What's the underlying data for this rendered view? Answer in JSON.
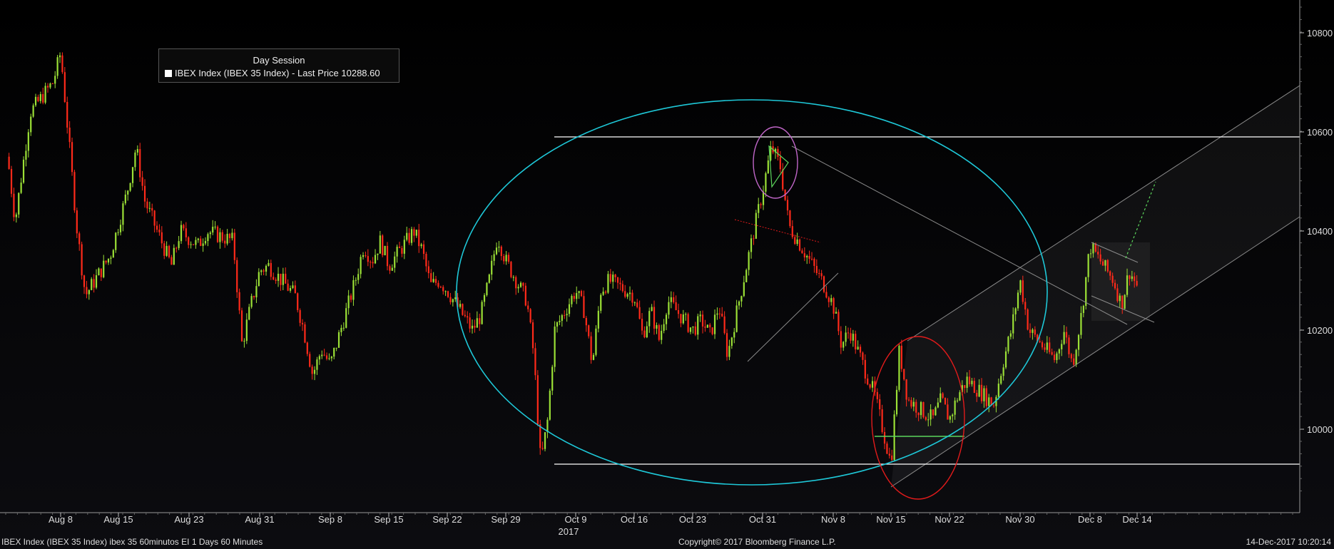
{
  "legend": {
    "session": "Day Session",
    "series_label": "IBEX Index (IBEX 35 Index) - Last Price 10288.60"
  },
  "footer": {
    "left": "IBEX Index (IBEX 35 Index) ibex 35 60minutos EI 1 Days 60 Minutes",
    "center": "Copyright© 2017 Bloomberg Finance L.P.",
    "right": "14-Dec-2017 10:20:14"
  },
  "colors": {
    "up": "#9be036",
    "down": "#ff2a1a",
    "background": "#000000",
    "cyan_ellipse": "#1ec8d8",
    "red_ellipse": "#e11b1b",
    "purple_ellipse": "#c066c8",
    "trend_lines": "#8a8a8a",
    "horizontal_lines": "#ffffff",
    "green_line": "#5cd65c"
  },
  "chart_data": {
    "type": "candlestick",
    "title": "",
    "series_name": "IBEX Index (IBEX 35 Index) - Last Price",
    "last_price": 10288.6,
    "interval": "60 Minutes",
    "y_axis": {
      "side": "right",
      "ticks": [
        10000,
        10200,
        10400,
        10600,
        10800
      ],
      "range": [
        9870,
        10870
      ]
    },
    "x_axis": {
      "ticks": [
        "Aug 8",
        "Aug 15",
        "Aug 23",
        "Aug 31",
        "Sep 8",
        "Sep 15",
        "Sep 22",
        "Sep 29",
        "Oct 9",
        "Oct 16",
        "Oct 23",
        "Oct 31",
        "Nov 8",
        "Nov 15",
        "Nov 22",
        "Nov 30",
        "Dec 8",
        "Dec 14"
      ],
      "year_label": "2017",
      "year_under": "Oct 9"
    },
    "grid": false,
    "legend_position": "top-left",
    "price_path": [
      [
        "Aug 1",
        10550
      ],
      [
        "Aug 2",
        10420
      ],
      [
        "Aug 4",
        10640
      ],
      [
        "Aug 7",
        10700
      ],
      [
        "Aug 8",
        10760
      ],
      [
        "Aug 9",
        10580
      ],
      [
        "Aug 10",
        10400
      ],
      [
        "Aug 11",
        10270
      ],
      [
        "Aug 14",
        10350
      ],
      [
        "Aug 16",
        10480
      ],
      [
        "Aug 17",
        10570
      ],
      [
        "Aug 18",
        10460
      ],
      [
        "Aug 21",
        10330
      ],
      [
        "Aug 22",
        10400
      ],
      [
        "Aug 24",
        10370
      ],
      [
        "Aug 25",
        10400
      ],
      [
        "Aug 28",
        10380
      ],
      [
        "Aug 29",
        10170
      ],
      [
        "Aug 30",
        10250
      ],
      [
        "Aug 31",
        10320
      ],
      [
        "Sep 1",
        10330
      ],
      [
        "Sep 4",
        10270
      ],
      [
        "Sep 5",
        10200
      ],
      [
        "Sep 6",
        10110
      ],
      [
        "Sep 7",
        10160
      ],
      [
        "Sep 8",
        10130
      ],
      [
        "Sep 11",
        10300
      ],
      [
        "Sep 12",
        10370
      ],
      [
        "Sep 13",
        10340
      ],
      [
        "Sep 14",
        10380
      ],
      [
        "Sep 15",
        10330
      ],
      [
        "Sep 18",
        10400
      ],
      [
        "Sep 19",
        10360
      ],
      [
        "Sep 20",
        10290
      ],
      [
        "Sep 21",
        10300
      ],
      [
        "Sep 22",
        10280
      ],
      [
        "Sep 25",
        10200
      ],
      [
        "Sep 26",
        10230
      ],
      [
        "Sep 27",
        10300
      ],
      [
        "Sep 28",
        10390
      ],
      [
        "Sep 29",
        10340
      ],
      [
        "Oct 2",
        10260
      ],
      [
        "Oct 3",
        10150
      ],
      [
        "Oct 4",
        9930
      ],
      [
        "Oct 5",
        10020
      ],
      [
        "Oct 6",
        10200
      ],
      [
        "Oct 9",
        10280
      ],
      [
        "Oct 10",
        10240
      ],
      [
        "Oct 11",
        10130
      ],
      [
        "Oct 12",
        10280
      ],
      [
        "Oct 13",
        10300
      ],
      [
        "Oct 16",
        10270
      ],
      [
        "Oct 17",
        10190
      ],
      [
        "Oct 18",
        10240
      ],
      [
        "Oct 19",
        10180
      ],
      [
        "Oct 20",
        10260
      ],
      [
        "Oct 23",
        10200
      ],
      [
        "Oct 24",
        10220
      ],
      [
        "Oct 25",
        10190
      ],
      [
        "Oct 26",
        10250
      ],
      [
        "Oct 27",
        10150
      ],
      [
        "Oct 30",
        10400
      ],
      [
        "Oct 31",
        10480
      ],
      [
        "Nov 1",
        10570
      ],
      [
        "Nov 2",
        10530
      ],
      [
        "Nov 3",
        10410
      ],
      [
        "Nov 6",
        10320
      ],
      [
        "Nov 7",
        10290
      ],
      [
        "Nov 8",
        10250
      ],
      [
        "Nov 9",
        10170
      ],
      [
        "Nov 10",
        10200
      ],
      [
        "Nov 13",
        10070
      ],
      [
        "Nov 14",
        10000
      ],
      [
        "Nov 15",
        9930
      ],
      [
        "Nov 16",
        10160
      ],
      [
        "Nov 17",
        10060
      ],
      [
        "Nov 20",
        10020
      ],
      [
        "Nov 21",
        10060
      ],
      [
        "Nov 22",
        10020
      ],
      [
        "Nov 23",
        10070
      ],
      [
        "Nov 24",
        10100
      ],
      [
        "Nov 27",
        10050
      ],
      [
        "Nov 28",
        10130
      ],
      [
        "Nov 29",
        10200
      ],
      [
        "Nov 30",
        10300
      ],
      [
        "Dec 1",
        10200
      ],
      [
        "Dec 4",
        10140
      ],
      [
        "Dec 5",
        10200
      ],
      [
        "Dec 6",
        10130
      ],
      [
        "Dec 7",
        10230
      ],
      [
        "Dec 8",
        10370
      ],
      [
        "Dec 11",
        10300
      ],
      [
        "Dec 12",
        10250
      ],
      [
        "Dec 13",
        10320
      ],
      [
        "Dec 14",
        10288.6
      ]
    ],
    "annotations": {
      "resistance_line": 10590,
      "support_line": 9930,
      "green_support": 9985,
      "cyan_ellipse": "price range Sep 22 – Dec 14",
      "red_ellipse": "Nov 15 low area",
      "purple_ellipse": "Oct 31 top",
      "rising_channel": "from Nov 15 low, projected upward",
      "dotted_projection": "upside projection from Dec 14"
    }
  }
}
